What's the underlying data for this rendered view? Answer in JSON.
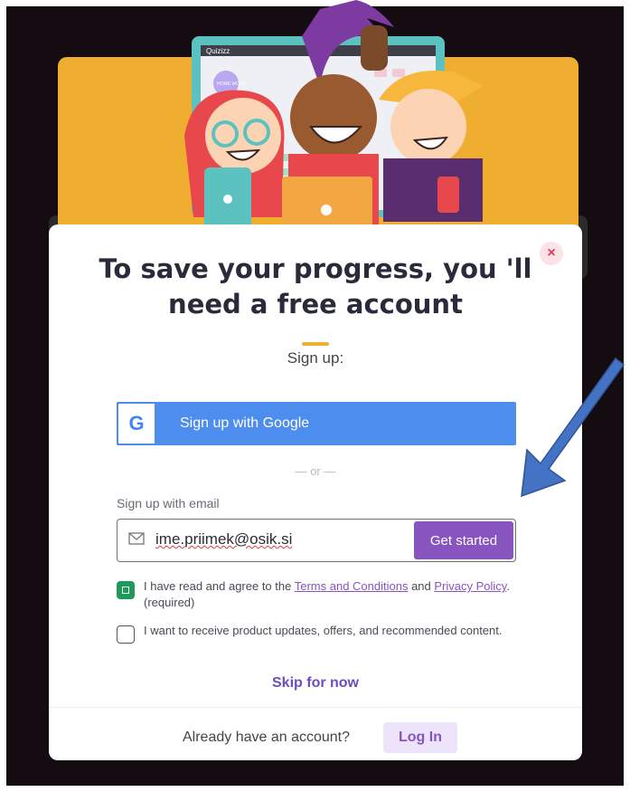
{
  "brand": {
    "logo_text": "Quizizz",
    "tile_text": "HOME WORK"
  },
  "modal": {
    "close_glyph": "×",
    "title": "To save your progress, you 'll need a free account",
    "signup_label": "Sign up:",
    "google_button": {
      "icon_letter": "G",
      "label": "Sign up with Google"
    },
    "or_text": "— or —",
    "email_label": "Sign up with email",
    "email_value": "ime.priimek@osik.si",
    "get_started": "Get started",
    "terms": {
      "prefix": "I have read and agree to the ",
      "terms_link": "Terms and Conditions",
      "and": " and ",
      "privacy_link": "Privacy Policy",
      "suffix": ". (required)",
      "checked": true
    },
    "updates": {
      "text": "I want to receive product updates, offers, and recommended content.",
      "checked": false
    },
    "skip": "Skip for now",
    "footer": {
      "text": "Already have an account?",
      "login": "Log In"
    }
  },
  "colors": {
    "accent_purple": "#8854c0",
    "google_blue": "#4c8ded",
    "illustration_yellow": "#efae2f",
    "check_green": "#1f9a5b",
    "annotation_arrow": "#4472c4"
  }
}
